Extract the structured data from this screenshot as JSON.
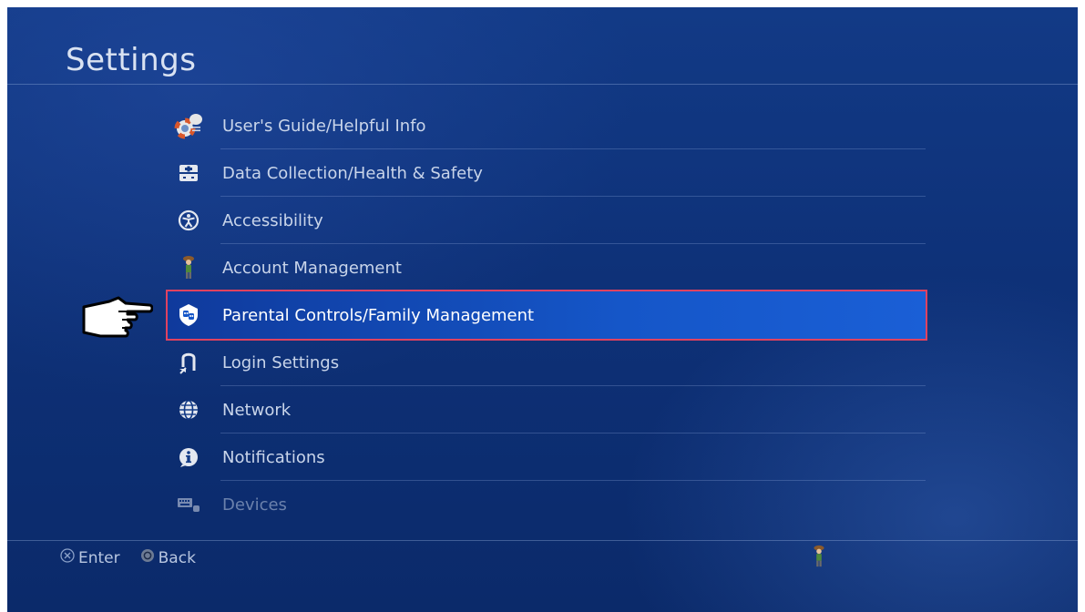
{
  "header": {
    "title": "Settings"
  },
  "menu": {
    "items": [
      {
        "label": "User's Guide/Helpful Info",
        "icon": "lifebuoy-speech-icon"
      },
      {
        "label": "Data Collection/Health & Safety",
        "icon": "first-aid-box-icon"
      },
      {
        "label": "Accessibility",
        "icon": "accessibility-icon"
      },
      {
        "label": "Account Management",
        "icon": "avatar-figure-icon"
      },
      {
        "label": "Parental Controls/Family Management",
        "icon": "family-shield-icon",
        "selected": true
      },
      {
        "label": "Login Settings",
        "icon": "login-arrow-icon"
      },
      {
        "label": "Network",
        "icon": "globe-icon"
      },
      {
        "label": "Notifications",
        "icon": "info-icon"
      },
      {
        "label": "Devices",
        "icon": "keyboard-device-icon"
      }
    ]
  },
  "footer": {
    "enter_label": "Enter",
    "back_label": "Back"
  },
  "colors": {
    "background": "#0e3178",
    "selection": "#1556c8",
    "highlight_outline": "#e0425f",
    "text": "#c9d5ea"
  }
}
